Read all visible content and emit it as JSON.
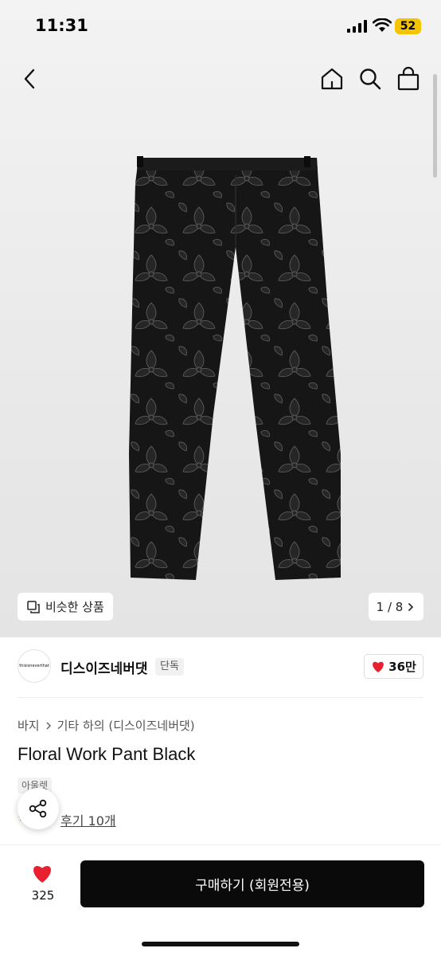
{
  "status_bar": {
    "time": "11:31",
    "battery": "52"
  },
  "nav": {
    "back_icon": "chevron-left-icon",
    "home_icon": "home-icon",
    "search_icon": "search-icon",
    "cart_icon": "shopping-bag-icon"
  },
  "gallery": {
    "similar_label": "비슷한 상품",
    "page_counter": "1 / 8"
  },
  "shop": {
    "logo_text": "thisisneverthat",
    "name": "디스이즈네버댓",
    "badge": "단독",
    "like_count": "36만"
  },
  "breadcrumb": {
    "category": "바지",
    "subcategory": "기타 하의 (디스이즈네버댓)"
  },
  "product": {
    "title": "Floral Work Pant Black",
    "tag": "아울렛",
    "review_link": "후기 10개"
  },
  "bottom_bar": {
    "wish_count": "325",
    "buy_label": "구매하기 (회원전용)"
  },
  "colors": {
    "accent": "#e8202f",
    "primary_button": "#0a0a0a"
  }
}
